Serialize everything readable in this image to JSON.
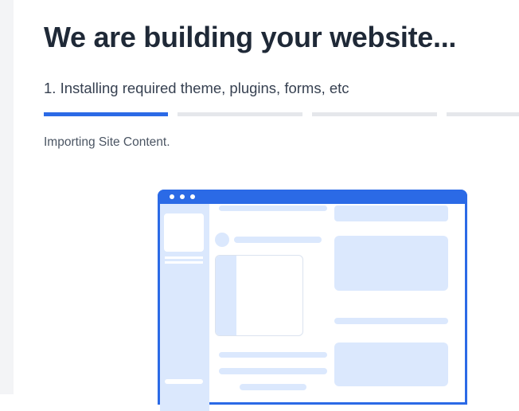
{
  "heading": "We are building your website...",
  "step": {
    "label": "1. Installing required theme, plugins, forms, etc",
    "current": 1,
    "total": 4
  },
  "status": "Importing Site Content.",
  "colors": {
    "accent": "#2b6ae6",
    "track": "#e5e7eb",
    "placeholder": "#dbe8fd",
    "heading": "#1f2937"
  },
  "illustration": {
    "kind": "website-wireframe",
    "frame_color": "#2b6ae6",
    "window_controls": [
      "dot",
      "dot",
      "dot"
    ]
  }
}
